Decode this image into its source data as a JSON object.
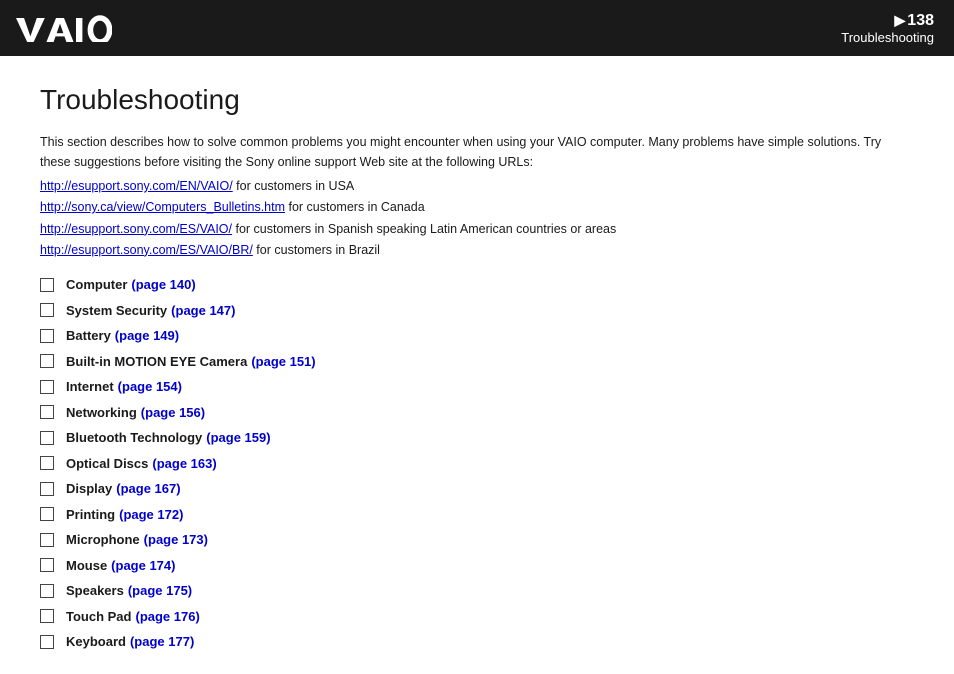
{
  "header": {
    "page_number": "138",
    "arrow": "▶",
    "section_title": "Troubleshooting"
  },
  "page": {
    "title": "Troubleshooting",
    "intro": "This section describes how to solve common problems you might encounter when using your VAIO computer. Many problems have simple solutions. Try these suggestions before visiting the Sony online support Web site at the following URLs:",
    "urls": [
      {
        "link": "http://esupport.sony.com/EN/VAIO/",
        "suffix": " for customers in USA"
      },
      {
        "link": "http://sony.ca/view/Computers_Bulletins.htm",
        "suffix": " for customers in Canada"
      },
      {
        "link": "http://esupport.sony.com/ES/VAIO/",
        "suffix": " for customers in Spanish speaking Latin American countries or areas"
      },
      {
        "link": "http://esupport.sony.com/ES/VAIO/BR/",
        "suffix": " for customers in Brazil"
      }
    ],
    "toc_items": [
      {
        "label": "Computer",
        "page_label": "(page 140)"
      },
      {
        "label": "System Security",
        "page_label": "(page 147)"
      },
      {
        "label": "Battery",
        "page_label": "(page 149)"
      },
      {
        "label": "Built-in MOTION EYE Camera",
        "page_label": "(page 151)"
      },
      {
        "label": "Internet",
        "page_label": "(page 154)"
      },
      {
        "label": "Networking",
        "page_label": "(page 156)"
      },
      {
        "label": "Bluetooth Technology",
        "page_label": "(page 159)"
      },
      {
        "label": "Optical Discs",
        "page_label": "(page 163)"
      },
      {
        "label": "Display",
        "page_label": "(page 167)"
      },
      {
        "label": "Printing",
        "page_label": "(page 172)"
      },
      {
        "label": "Microphone",
        "page_label": "(page 173)"
      },
      {
        "label": "Mouse",
        "page_label": "(page 174)"
      },
      {
        "label": "Speakers",
        "page_label": "(page 175)"
      },
      {
        "label": "Touch Pad",
        "page_label": "(page 176)"
      },
      {
        "label": "Keyboard",
        "page_label": "(page 177)"
      }
    ]
  }
}
